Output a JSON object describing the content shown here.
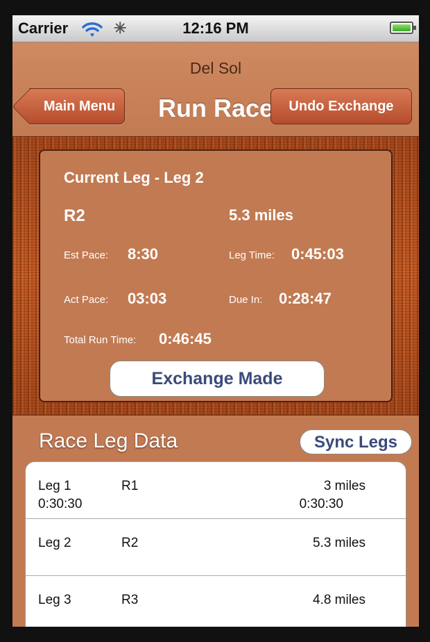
{
  "status_bar": {
    "carrier": "Carrier",
    "time": "12:16 PM",
    "wifi_icon": "wifi-icon",
    "activity_icon": "activity-spinner-icon",
    "battery_icon": "battery-icon"
  },
  "nav": {
    "subtitle": "Del Sol",
    "title": "Run Race",
    "back_label": "Main Menu",
    "undo_label": "Undo Exchange"
  },
  "current_leg": {
    "heading": "Current Leg - Leg 2",
    "runner": "R2",
    "distance": "5.3 miles",
    "est_pace_label": "Est Pace:",
    "est_pace": "8:30",
    "leg_time_label": "Leg Time:",
    "leg_time": "0:45:03",
    "act_pace_label": "Act Pace:",
    "act_pace": "03:03",
    "due_in_label": "Due In:",
    "due_in": "0:28:47",
    "total_label": "Total Run Time:",
    "total": "0:46:45",
    "exchange_label": "Exchange Made"
  },
  "leg_data": {
    "title": "Race Leg Data",
    "sync_label": "Sync Legs",
    "rows": [
      {
        "leg": "Leg 1",
        "runner": "R1",
        "distance": "3 miles",
        "time_left": "0:30:30",
        "time_right": "0:30:30"
      },
      {
        "leg": "Leg 2",
        "runner": "R2",
        "distance": "5.3 miles",
        "time_left": "",
        "time_right": ""
      },
      {
        "leg": "Leg 3",
        "runner": "R3",
        "distance": "4.8 miles",
        "time_left": "",
        "time_right": ""
      }
    ]
  },
  "colors": {
    "background": "#c27a52",
    "button": "#b54c2c",
    "wood": "#a4471c",
    "link_text": "#3a4a7a"
  }
}
